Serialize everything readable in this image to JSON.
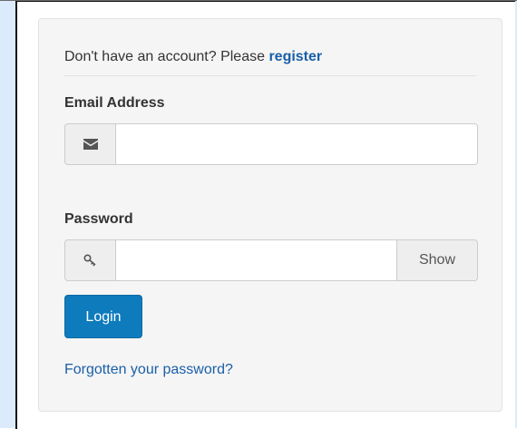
{
  "login_panel": {
    "register_prompt": "Don't have an account? Please ",
    "register_link": "register",
    "email_label": "Email Address",
    "email_icon": "envelope-icon",
    "email_value": "",
    "email_placeholder": "",
    "password_label": "Password",
    "password_icon": "key-icon",
    "password_value": "",
    "password_placeholder": "",
    "show_label": "Show",
    "login_label": "Login",
    "forgot_link": "Forgotten your password?"
  },
  "colors": {
    "link": "#1a5fa8",
    "primary_button": "#0e7bbd",
    "panel_background": "#f5f5f5",
    "page_background": "#dcebfb"
  }
}
